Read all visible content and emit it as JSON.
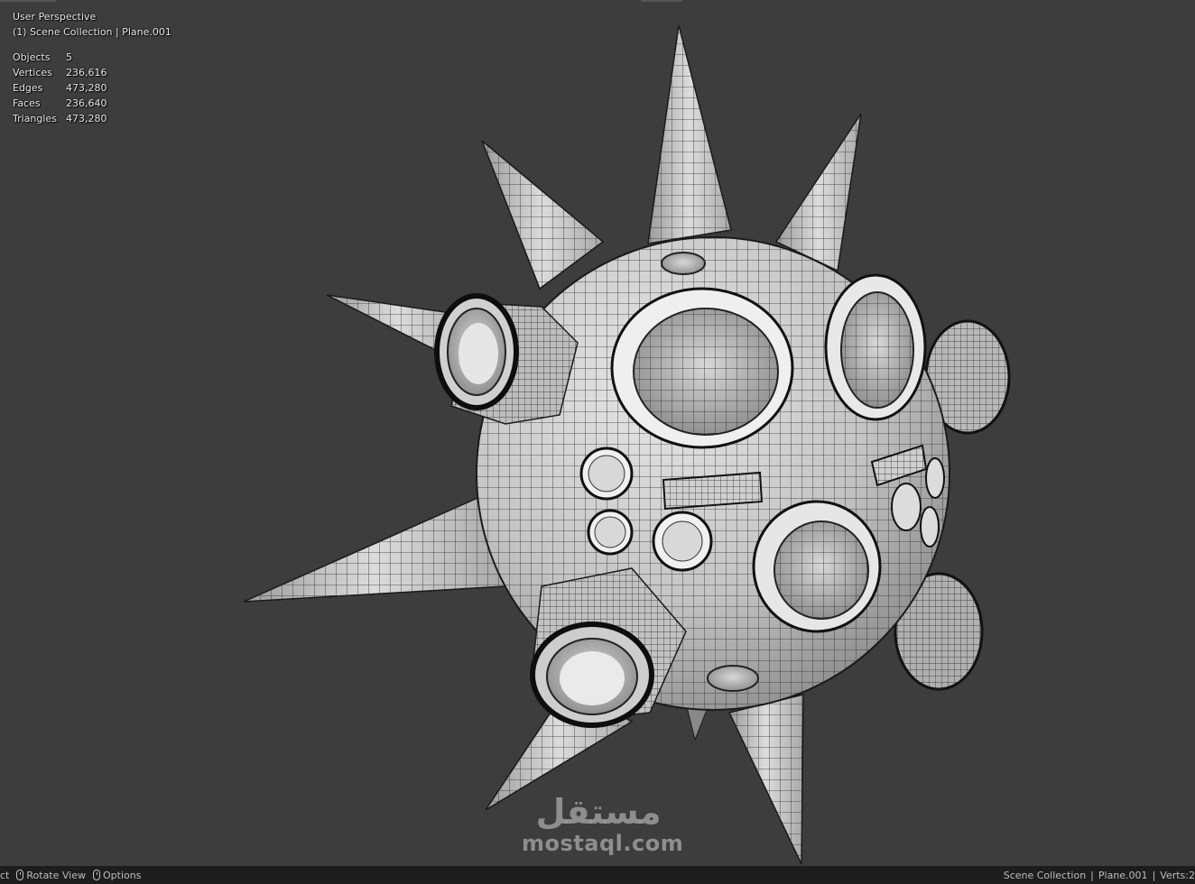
{
  "viewport": {
    "view_name": "User Perspective",
    "collection_line": "(1) Scene Collection | Plane.001",
    "stats": [
      {
        "label": "Objects",
        "value": "5"
      },
      {
        "label": "Vertices",
        "value": "236,616"
      },
      {
        "label": "Edges",
        "value": "473,280"
      },
      {
        "label": "Faces",
        "value": "236,640"
      },
      {
        "label": "Triangles",
        "value": "473,280"
      }
    ],
    "model_icon": "spiked-sphere-wireframe-mesh"
  },
  "watermark": {
    "arabic": "مستقل",
    "latin": "mostaql.com"
  },
  "statusbar": {
    "left_cut": "ct",
    "rotate_label": "Rotate View",
    "options_label": "Options",
    "collection": "Scene Collection",
    "object": "Plane.001",
    "verts_cut": "Verts:2"
  },
  "colors": {
    "background": "#3d3d3d",
    "statusbar": "#1d1d1d",
    "mesh_fill": "#c8c8c8",
    "wire": "#2a2a2a"
  }
}
